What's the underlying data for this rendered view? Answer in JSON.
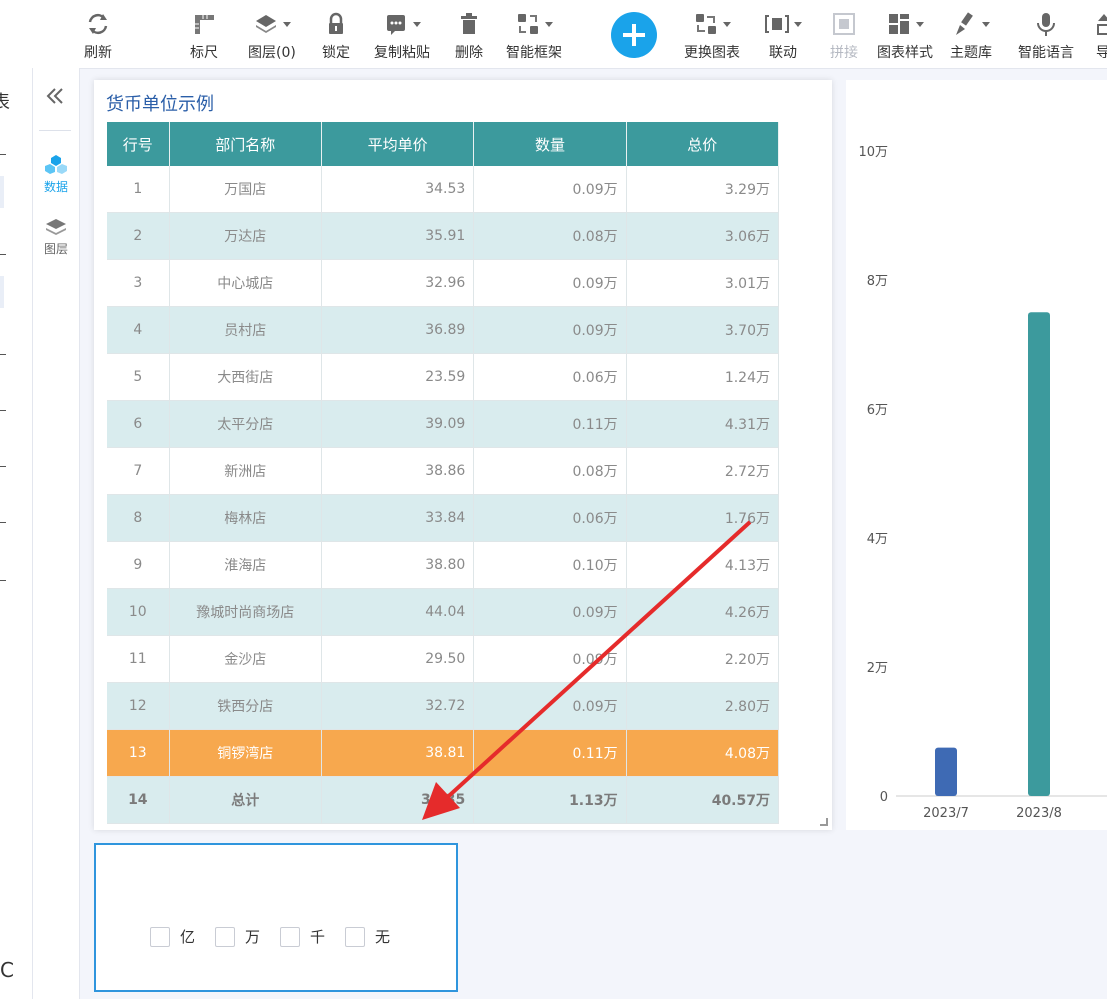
{
  "toolbar": {
    "refresh": "刷新",
    "ruler": "标尺",
    "layers": "图层(0)",
    "lock": "锁定",
    "copy_paste": "复制粘贴",
    "delete": "删除",
    "smart_frame": "智能框架",
    "switch_chart": "更换图表",
    "linkage": "联动",
    "splice": "拼接",
    "chart_style": "图表样式",
    "theme_library": "主题库",
    "smart_language": "智能语言",
    "truncated_next": "导"
  },
  "sidenav": {
    "data_label": "数据",
    "layers_label": "图层"
  },
  "left_strip": {
    "top_char": "表",
    "bottom_char": "C"
  },
  "table": {
    "title": "货币单位示例",
    "headers": [
      "行号",
      "部门名称",
      "平均单价",
      "数量",
      "总价"
    ],
    "rows": [
      [
        "1",
        "万国店",
        "34.53",
        "0.09万",
        "3.29万"
      ],
      [
        "2",
        "万达店",
        "35.91",
        "0.08万",
        "3.06万"
      ],
      [
        "3",
        "中心城店",
        "32.96",
        "0.09万",
        "3.01万"
      ],
      [
        "4",
        "员村店",
        "36.89",
        "0.09万",
        "3.70万"
      ],
      [
        "5",
        "大西街店",
        "23.59",
        "0.06万",
        "1.24万"
      ],
      [
        "6",
        "太平分店",
        "39.09",
        "0.11万",
        "4.31万"
      ],
      [
        "7",
        "新洲店",
        "38.86",
        "0.08万",
        "2.72万"
      ],
      [
        "8",
        "梅林店",
        "33.84",
        "0.06万",
        "1.76万"
      ],
      [
        "9",
        "淮海店",
        "38.80",
        "0.10万",
        "4.13万"
      ],
      [
        "10",
        "豫城时尚商场店",
        "44.04",
        "0.09万",
        "4.26万"
      ],
      [
        "11",
        "金沙店",
        "29.50",
        "0.09万",
        "2.20万"
      ],
      [
        "12",
        "铁西分店",
        "32.72",
        "0.09万",
        "2.80万"
      ],
      [
        "13",
        "铜锣湾店",
        "38.81",
        "0.11万",
        "4.08万"
      ]
    ],
    "highlight_row": 13,
    "total": [
      "14",
      "总计",
      "35.35",
      "1.13万",
      "40.57万"
    ],
    "colors": {
      "header": "#3c9a9d",
      "stripe": "#d9ecee",
      "highlight": "#f7a84e",
      "title": "#2a5ea8"
    }
  },
  "chart_data": {
    "type": "bar",
    "categories": [
      "2023/7",
      "2023/8"
    ],
    "values": [
      7500,
      75000
    ],
    "bar_colors": [
      "#3e6ab4",
      "#3c9a9d"
    ],
    "y_ticks": [
      "0",
      "2万",
      "4万",
      "6万",
      "8万",
      "10万"
    ],
    "ylim": [
      0,
      100000
    ]
  },
  "unit_checkboxes": [
    {
      "label": "亿",
      "checked": false
    },
    {
      "label": "万",
      "checked": false
    },
    {
      "label": "千",
      "checked": false
    },
    {
      "label": "无",
      "checked": false
    }
  ],
  "annotation_arrow_color": "#e52b2b"
}
